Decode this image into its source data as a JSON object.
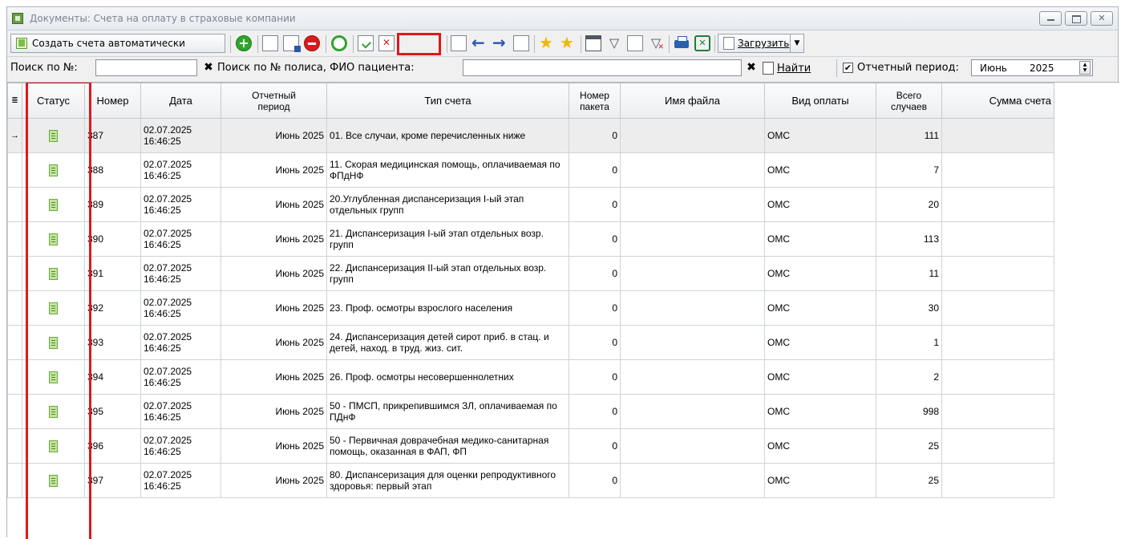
{
  "window": {
    "title": "Документы: Счета на оплату в страховые компании",
    "close_glyph": "✕"
  },
  "toolbar": {
    "create_auto_label": "Создать счета автоматически",
    "load_label": "Загрузить"
  },
  "search": {
    "number_label": "Поиск по №:",
    "number_value": "",
    "policy_label": "Поиск по № полиса, ФИО пациента:",
    "policy_value": "",
    "clear_glyph": "✖",
    "find_label": "Найти",
    "report_period_label": "Отчетный период:",
    "report_period_checked": true,
    "period_month": "Июнь",
    "period_year": "2025"
  },
  "grid": {
    "columns": [
      "Статус",
      "Номер",
      "Дата",
      "Отчетный период",
      "Тип счета",
      "Номер пакета",
      "Имя файла",
      "Вид оплаты",
      "Всего случаев",
      "Сумма счета"
    ],
    "rows": [
      {
        "number": "387",
        "date": "02.07.2025 16:46:25",
        "period": "Июнь 2025",
        "type": "01. Все случаи, кроме перечисленных ниже",
        "package": "0",
        "file": "",
        "payment": "ОМС",
        "cases": "111"
      },
      {
        "number": "388",
        "date": "02.07.2025 16:46:25",
        "period": "Июнь 2025",
        "type": "11. Скорая медицинская помощь, оплачиваемая по ФПдНФ",
        "package": "0",
        "file": "",
        "payment": "ОМС",
        "cases": "7"
      },
      {
        "number": "389",
        "date": "02.07.2025 16:46:25",
        "period": "Июнь 2025",
        "type": "20.Углубленная диспансеризация I-ый этап отдельных групп",
        "package": "0",
        "file": "",
        "payment": "ОМС",
        "cases": "20"
      },
      {
        "number": "390",
        "date": "02.07.2025 16:46:25",
        "period": "Июнь 2025",
        "type": "21. Диспансеризация I-ый этап отдельных возр. групп",
        "package": "0",
        "file": "",
        "payment": "ОМС",
        "cases": "113"
      },
      {
        "number": "391",
        "date": "02.07.2025 16:46:25",
        "period": "Июнь 2025",
        "type": "22. Диспансеризация II-ый этап отдельных возр. групп",
        "package": "0",
        "file": "",
        "payment": "ОМС",
        "cases": "11"
      },
      {
        "number": "392",
        "date": "02.07.2025 16:46:25",
        "period": "Июнь 2025",
        "type": "23. Проф. осмотры взрослого населения",
        "package": "0",
        "file": "",
        "payment": "ОМС",
        "cases": "30"
      },
      {
        "number": "393",
        "date": "02.07.2025 16:46:25",
        "period": "Июнь 2025",
        "type": "24. Диспансеризация детей сирот приб. в стац. и детей, наход. в труд. жиз. сит.",
        "package": "0",
        "file": "",
        "payment": "ОМС",
        "cases": "1"
      },
      {
        "number": "394",
        "date": "02.07.2025 16:46:25",
        "period": "Июнь 2025",
        "type": "26. Проф. осмотры несовершеннолетних",
        "package": "0",
        "file": "",
        "payment": "ОМС",
        "cases": "2"
      },
      {
        "number": "395",
        "date": "02.07.2025 16:46:25",
        "period": "Июнь 2025",
        "type": "50 - ПМСП, прикрепившимся ЗЛ, оплачиваемая по ПДнФ",
        "package": "0",
        "file": "",
        "payment": "ОМС",
        "cases": "998"
      },
      {
        "number": "396",
        "date": "02.07.2025 16:46:25",
        "period": "Июнь 2025",
        "type": "50 - Первичная доврачебная медико-санитарная помощь, оказанная в ФАП, ФП",
        "package": "0",
        "file": "",
        "payment": "ОМС",
        "cases": "25"
      },
      {
        "number": "397",
        "date": "02.07.2025 16:46:25",
        "period": "Июнь 2025",
        "type": "80. Диспансеризация для оценки репродуктивного здоровья: первый этап",
        "package": "0",
        "file": "",
        "payment": "ОМС",
        "cases": "25"
      }
    ],
    "selected_row_indicator": "→"
  }
}
